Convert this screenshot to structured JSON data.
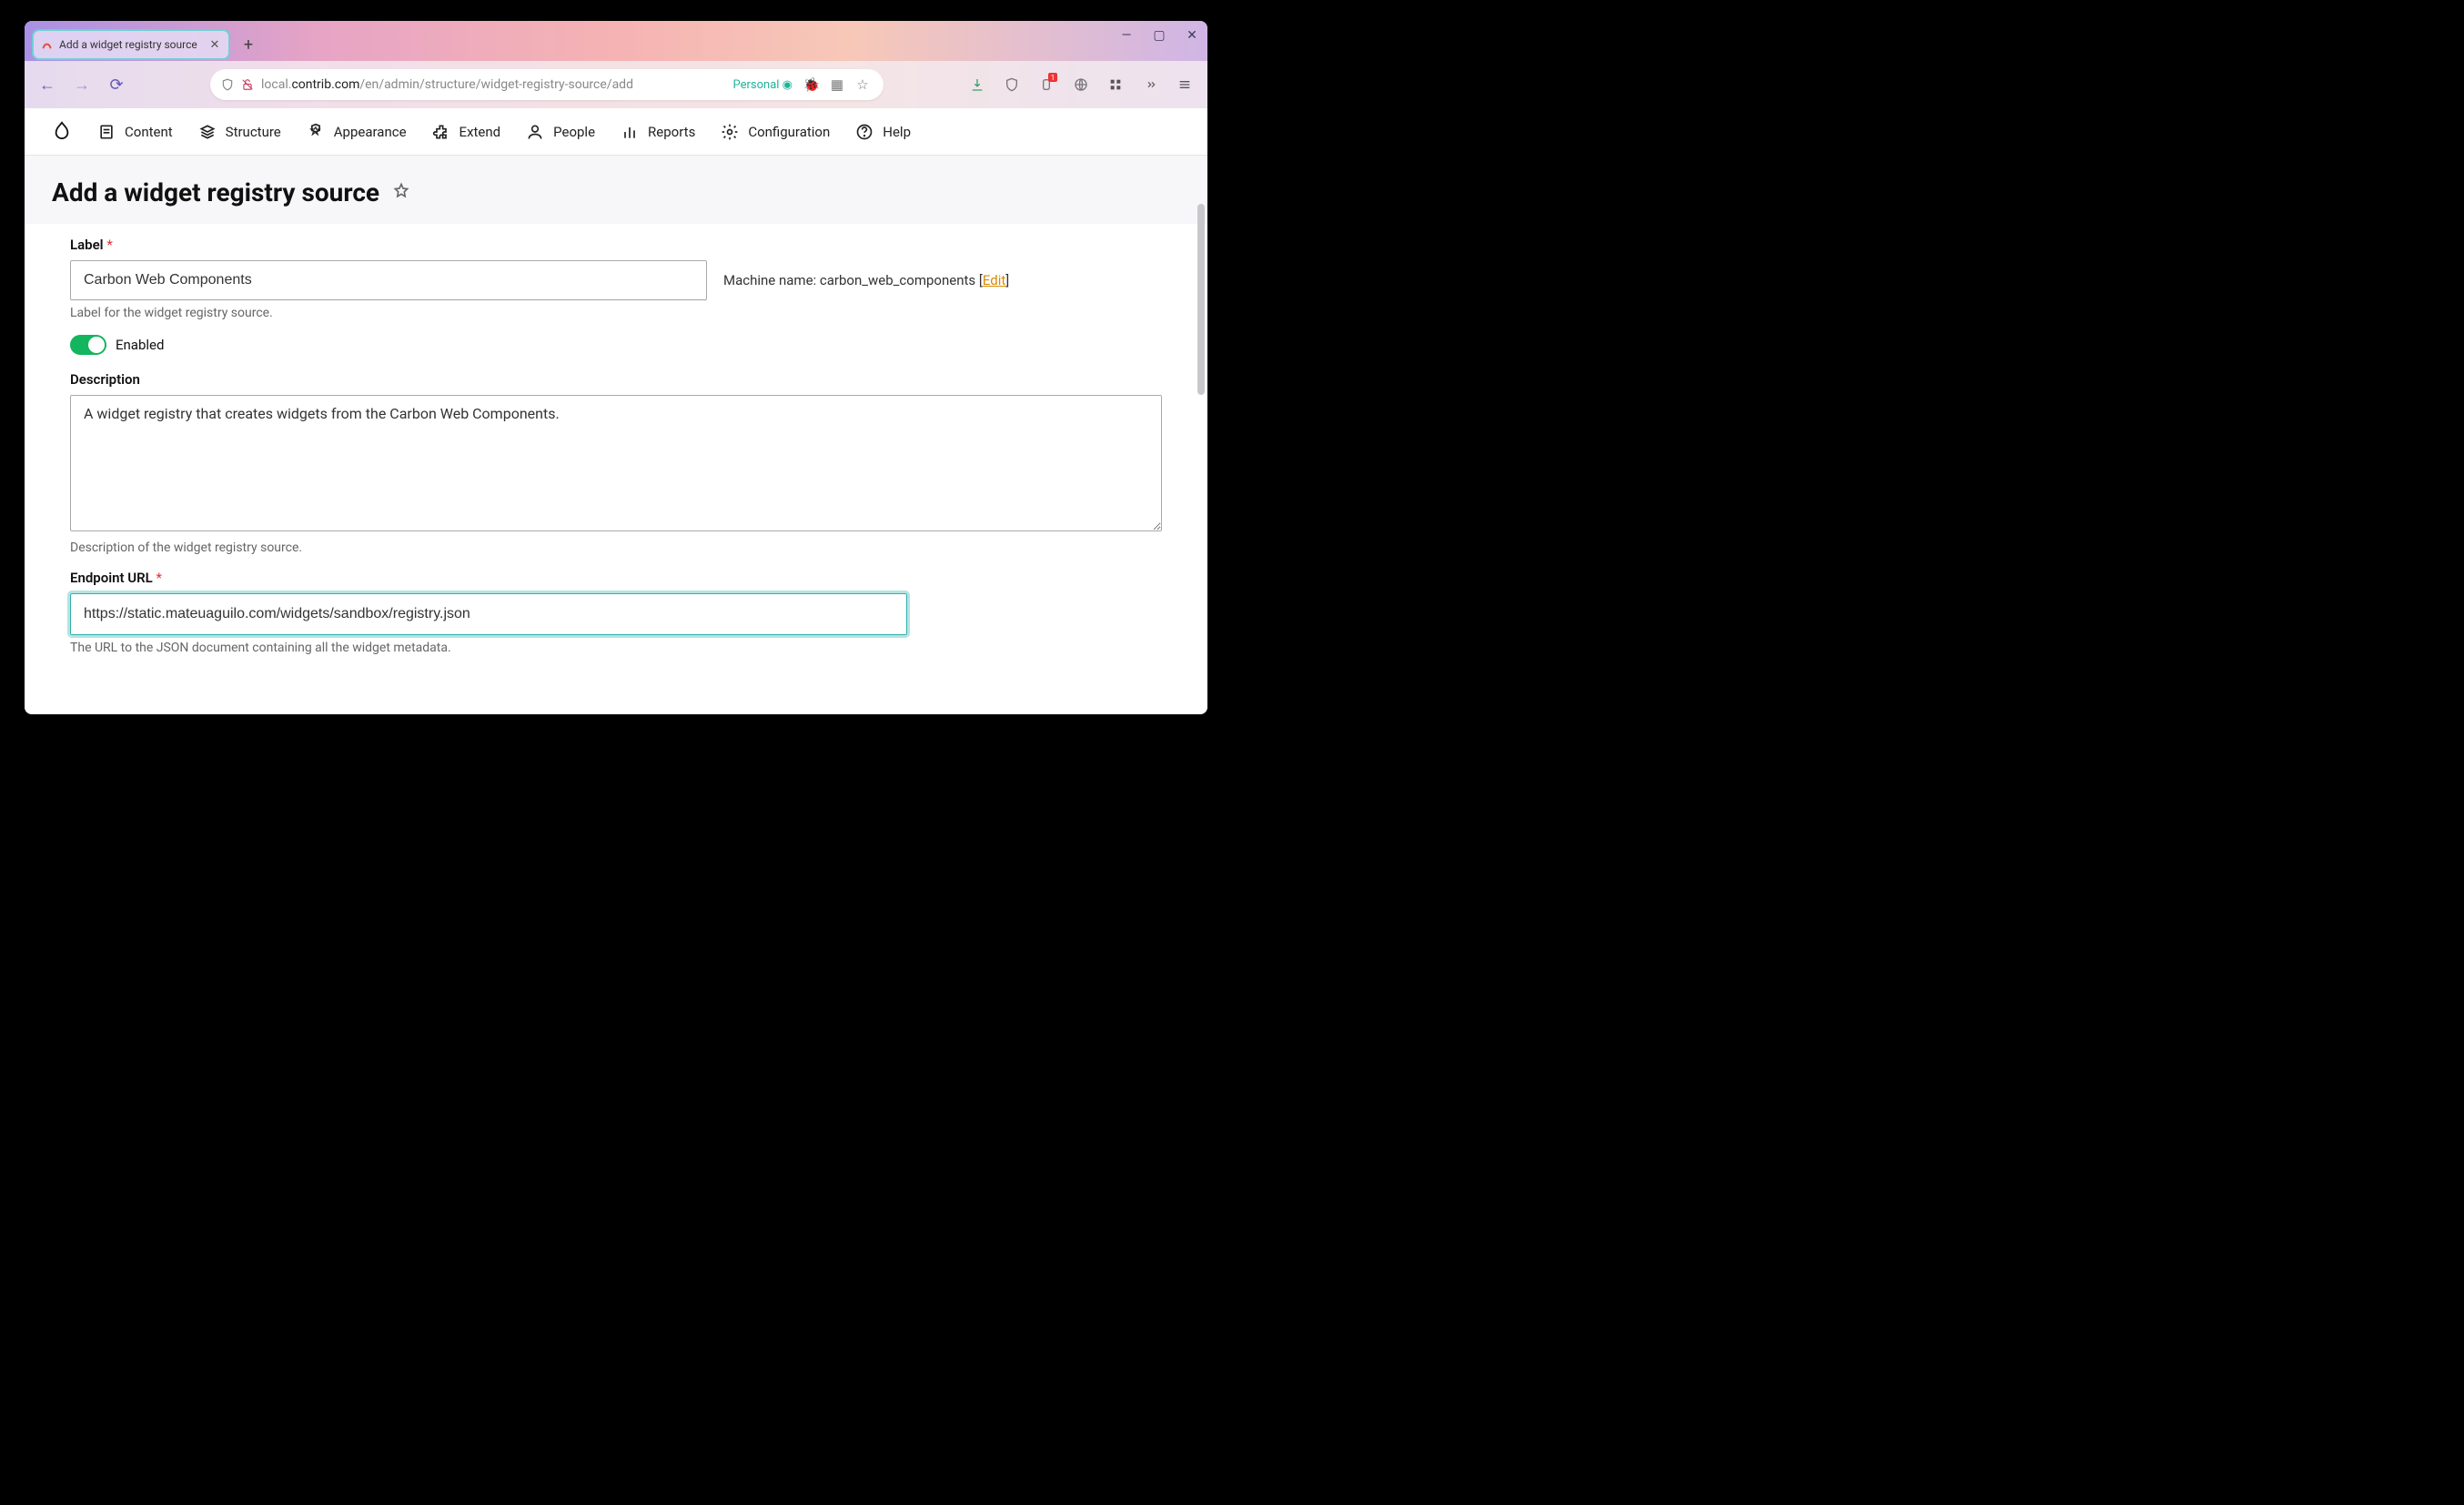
{
  "browser": {
    "tab_title": "Add a widget registry source",
    "url_prefix": "local.",
    "url_domain": "contrib.com",
    "url_path": "/en/admin/structure/widget-registry-source/add",
    "container_label": "Personal",
    "badge_count": "1"
  },
  "admin_nav": {
    "items": [
      {
        "label": "Content"
      },
      {
        "label": "Structure"
      },
      {
        "label": "Appearance"
      },
      {
        "label": "Extend"
      },
      {
        "label": "People"
      },
      {
        "label": "Reports"
      },
      {
        "label": "Configuration"
      },
      {
        "label": "Help"
      }
    ]
  },
  "page": {
    "title": "Add a widget registry source"
  },
  "form": {
    "label_label": "Label",
    "label_value": "Carbon Web Components",
    "label_help": "Label for the widget registry source.",
    "machine_name_prefix": "Machine name: ",
    "machine_name_value": "carbon_web_components",
    "machine_name_edit": "Edit",
    "enabled_label": "Enabled",
    "description_label": "Description",
    "description_value": "A widget registry that creates widgets from the Carbon Web Components.",
    "description_help": "Description of the widget registry source.",
    "endpoint_label": "Endpoint URL",
    "endpoint_value": "https://static.mateuaguilo.com/widgets/sandbox/registry.json",
    "endpoint_help": "The URL to the JSON document containing all the widget metadata."
  }
}
